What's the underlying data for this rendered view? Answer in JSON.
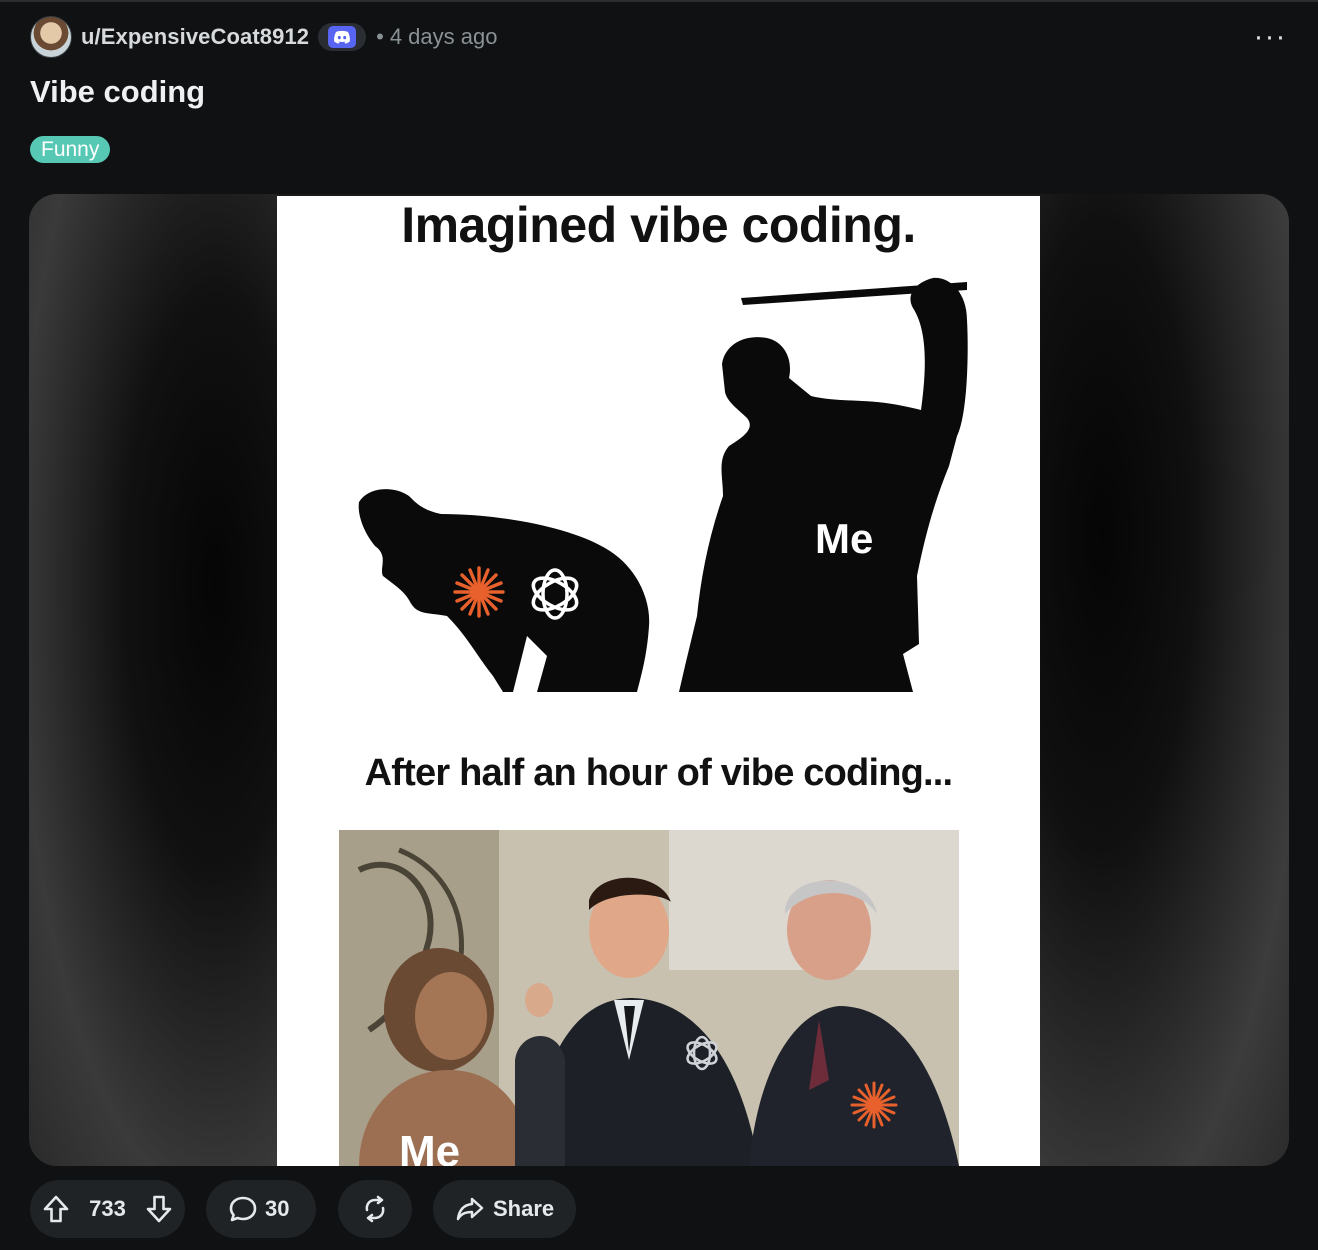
{
  "post": {
    "author": "u/ExpensiveCoat8912",
    "separator": "•",
    "time_ago": "4 days ago",
    "more_label": "···",
    "title": "Vibe coding",
    "flair": "Funny"
  },
  "meme": {
    "top_caption": "Imagined vibe coding.",
    "top_figure_label": "Me",
    "middle_caption": "After half an hour of vibe coding...",
    "bottom_figure_label": "Me"
  },
  "actions": {
    "upvotes": "733",
    "comments": "30",
    "share_label": "Share"
  },
  "colors": {
    "background": "#0f1113",
    "flair": "#56c8b4",
    "discord": "#5865f2",
    "accent_orange": "#e8612c",
    "pill": "#1f2326"
  },
  "icons": [
    "avatar",
    "discord-icon",
    "more-icon",
    "upvote-icon",
    "downvote-icon",
    "comment-icon",
    "crosspost-icon",
    "share-icon"
  ]
}
